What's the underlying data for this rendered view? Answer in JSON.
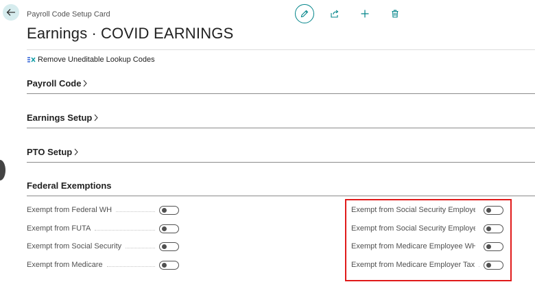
{
  "header": {
    "card_label": "Payroll Code Setup Card",
    "title_part1": "Earnings",
    "title_separator": "·",
    "title_part2": "COVID EARNINGS"
  },
  "toolbar": {
    "icons": [
      "edit-icon",
      "share-icon",
      "new-icon",
      "delete-icon"
    ],
    "accent_color": "#008489"
  },
  "actions": {
    "remove_uneditable": "Remove Uneditable Lookup Codes"
  },
  "sections": {
    "payroll_code": "Payroll Code",
    "earnings_setup": "Earnings Setup",
    "pto_setup": "PTO Setup",
    "federal_exemptions": "Federal Exemptions"
  },
  "federal_exemptions": {
    "left": [
      {
        "label": "Exempt from Federal WH",
        "value": false
      },
      {
        "label": "Exempt from FUTA",
        "value": false
      },
      {
        "label": "Exempt from Social Security",
        "value": false
      },
      {
        "label": "Exempt from Medicare",
        "value": false
      }
    ],
    "right": [
      {
        "label": "Exempt from Social Security Employe...",
        "value": false
      },
      {
        "label": "Exempt from Social Security Employer...",
        "value": false
      },
      {
        "label": "Exempt from Medicare Employee WH ...",
        "value": false
      },
      {
        "label": "Exempt from Medicare Employer Tax",
        "value": false
      }
    ],
    "highlight_color": "#e01919"
  }
}
